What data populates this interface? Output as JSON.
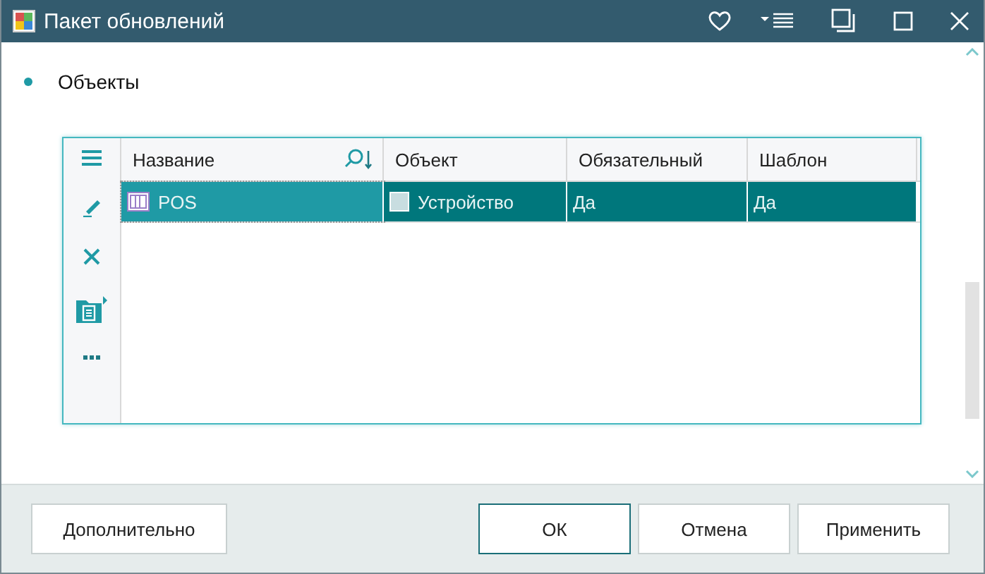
{
  "window": {
    "title": "Пакет обновлений"
  },
  "section": {
    "title": "Объекты"
  },
  "table": {
    "columns": [
      {
        "label": "Название",
        "sortable": true
      },
      {
        "label": "Объект",
        "sortable": false
      },
      {
        "label": "Обязательный",
        "sortable": false
      },
      {
        "label": "Шаблон",
        "sortable": false
      }
    ],
    "rows": [
      {
        "selected": true,
        "cells": [
          {
            "text": "POS",
            "focused": true
          },
          {
            "text": "Устройство",
            "focused": false
          },
          {
            "text": "Да",
            "focused": false
          },
          {
            "text": "Да",
            "focused": false
          }
        ]
      }
    ]
  },
  "buttons": [
    {
      "label": "Дополнительно",
      "default": false
    },
    {
      "label": "ОК",
      "default": true
    },
    {
      "label": "Отмена",
      "default": false
    },
    {
      "label": "Применить",
      "default": false
    }
  ]
}
